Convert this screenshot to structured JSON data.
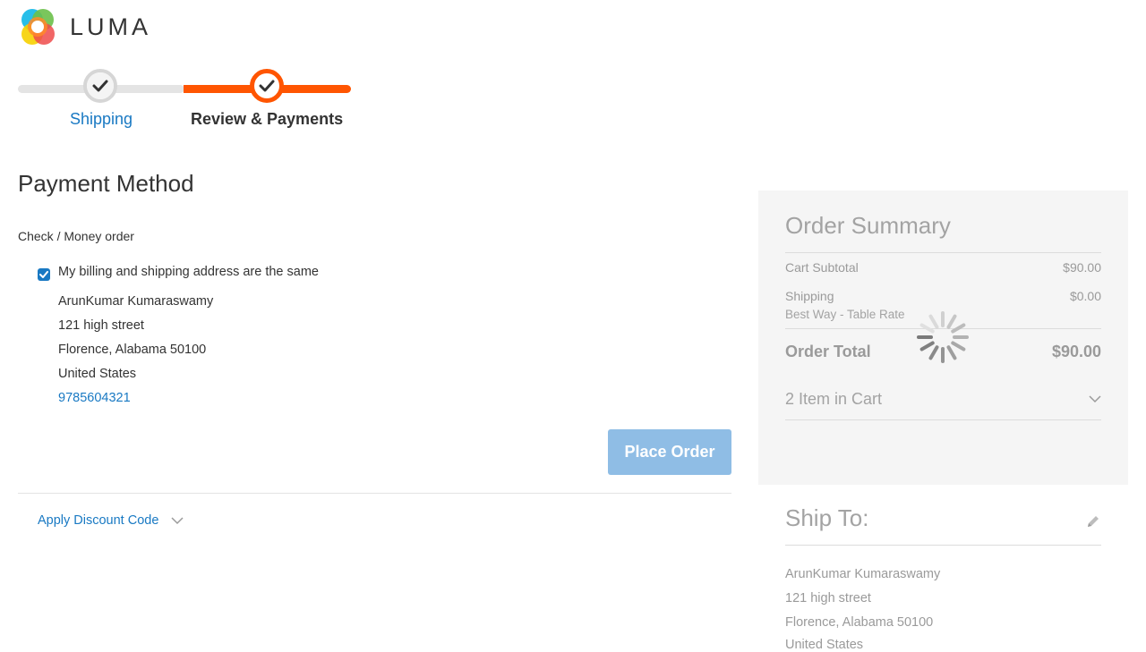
{
  "brand": {
    "name": "LUMA",
    "colors": {
      "blue": "#1979c3",
      "orange": "#ff5501",
      "yellow": "#f6d000",
      "green": "#6cc04a",
      "red": "#ef4b4b",
      "teal": "#1bbbe8"
    }
  },
  "progress": {
    "steps": [
      {
        "label": "Shipping",
        "state": "complete",
        "icon": "check-icon"
      },
      {
        "label": "Review & Payments",
        "state": "active",
        "icon": "check-icon"
      }
    ]
  },
  "payment": {
    "title": "Payment Method",
    "method_label": "Check / Money order",
    "same_address": {
      "label": "My billing and shipping address are the same",
      "checked": true
    },
    "address": {
      "name": "ArunKumar Kumaraswamy",
      "street": "121 high street",
      "city_line": "Florence, Alabama 50100",
      "country": "United States",
      "phone": "9785604321"
    },
    "place_order_label": "Place Order",
    "discount_label": "Apply Discount Code"
  },
  "summary": {
    "title": "Order Summary",
    "subtotal_label": "Cart Subtotal",
    "subtotal_value": "$90.00",
    "shipping_label": "Shipping",
    "shipping_value": "$0.00",
    "shipping_method": "Best Way - Table Rate",
    "total_label": "Order Total",
    "total_value": "$90.00",
    "items_label": "2 Item in Cart",
    "loading": true
  },
  "ship_to": {
    "title": "Ship To:",
    "name": "ArunKumar Kumaraswamy",
    "street": "121 high street",
    "city_line": "Florence, Alabama 50100",
    "country": "United States"
  }
}
